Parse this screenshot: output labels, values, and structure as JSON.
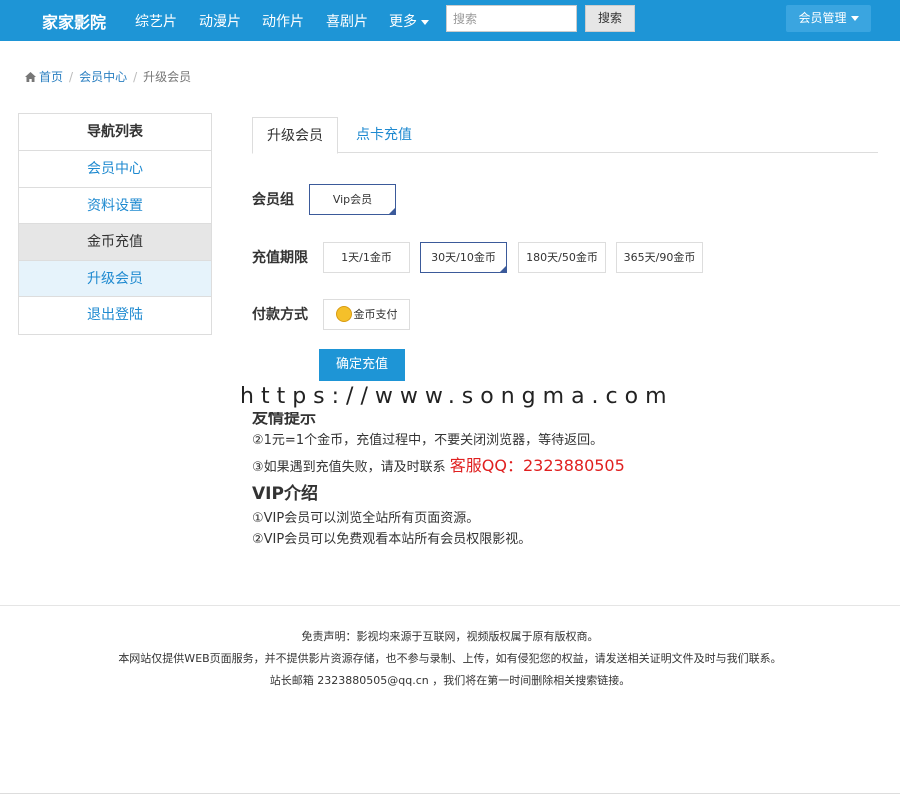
{
  "navbar": {
    "brand": "家家影院",
    "links": [
      "综艺片",
      "动漫片",
      "动作片",
      "喜剧片"
    ],
    "more": "更多",
    "search_placeholder": "搜索",
    "search_button": "搜索",
    "member_menu": "会员管理"
  },
  "breadcrumb": {
    "home": "首页",
    "member_center": "会员中心",
    "current": "升级会员"
  },
  "sidebar": {
    "title": "导航列表",
    "items": [
      "会员中心",
      "资料设置",
      "金币充值",
      "升级会员",
      "退出登陆"
    ]
  },
  "tabs": [
    "升级会员",
    "点卡充值"
  ],
  "form": {
    "group_label": "会员组",
    "group_option": "Vip会员",
    "period_label": "充值期限",
    "periods": [
      "1天/1金币",
      "30天/10金币",
      "180天/50金币",
      "365天/90金币"
    ],
    "payment_label": "付款方式",
    "payment_option": "金币支付",
    "submit": "确定充值"
  },
  "watermark": "https://www.songma.com",
  "notes": {
    "title": "友情提示",
    "line2": "②1元=1个金币，充值过程中，不要关闭浏览器，等待返回。",
    "line3": "③如果遇到充值失败，请及时联系",
    "kefu": "客服QQ：2323880505",
    "vip_title": "VIP介绍",
    "vip1": "①VIP会员可以浏览全站所有页面资源。",
    "vip2": "②VIP会员可以免费观看本站所有会员权限影视。"
  },
  "footer": {
    "line1": "免责声明：影视均来源于互联网，视频版权属于原有版权商。",
    "line2": "本网站仅提供WEB页面服务，并不提供影片资源存储，也不参与录制、上传，如有侵犯您的权益，请发送相关证明文件及时与我们联系。",
    "line3": "站长邮箱 2323880505@qq.cn ，我们将在第一时间删除相关搜索链接。"
  },
  "colors": {
    "navbar": "#1e95d6",
    "link": "#1f8ad0",
    "kefu": "#e02020",
    "selected_border": "#3b5a9a"
  }
}
